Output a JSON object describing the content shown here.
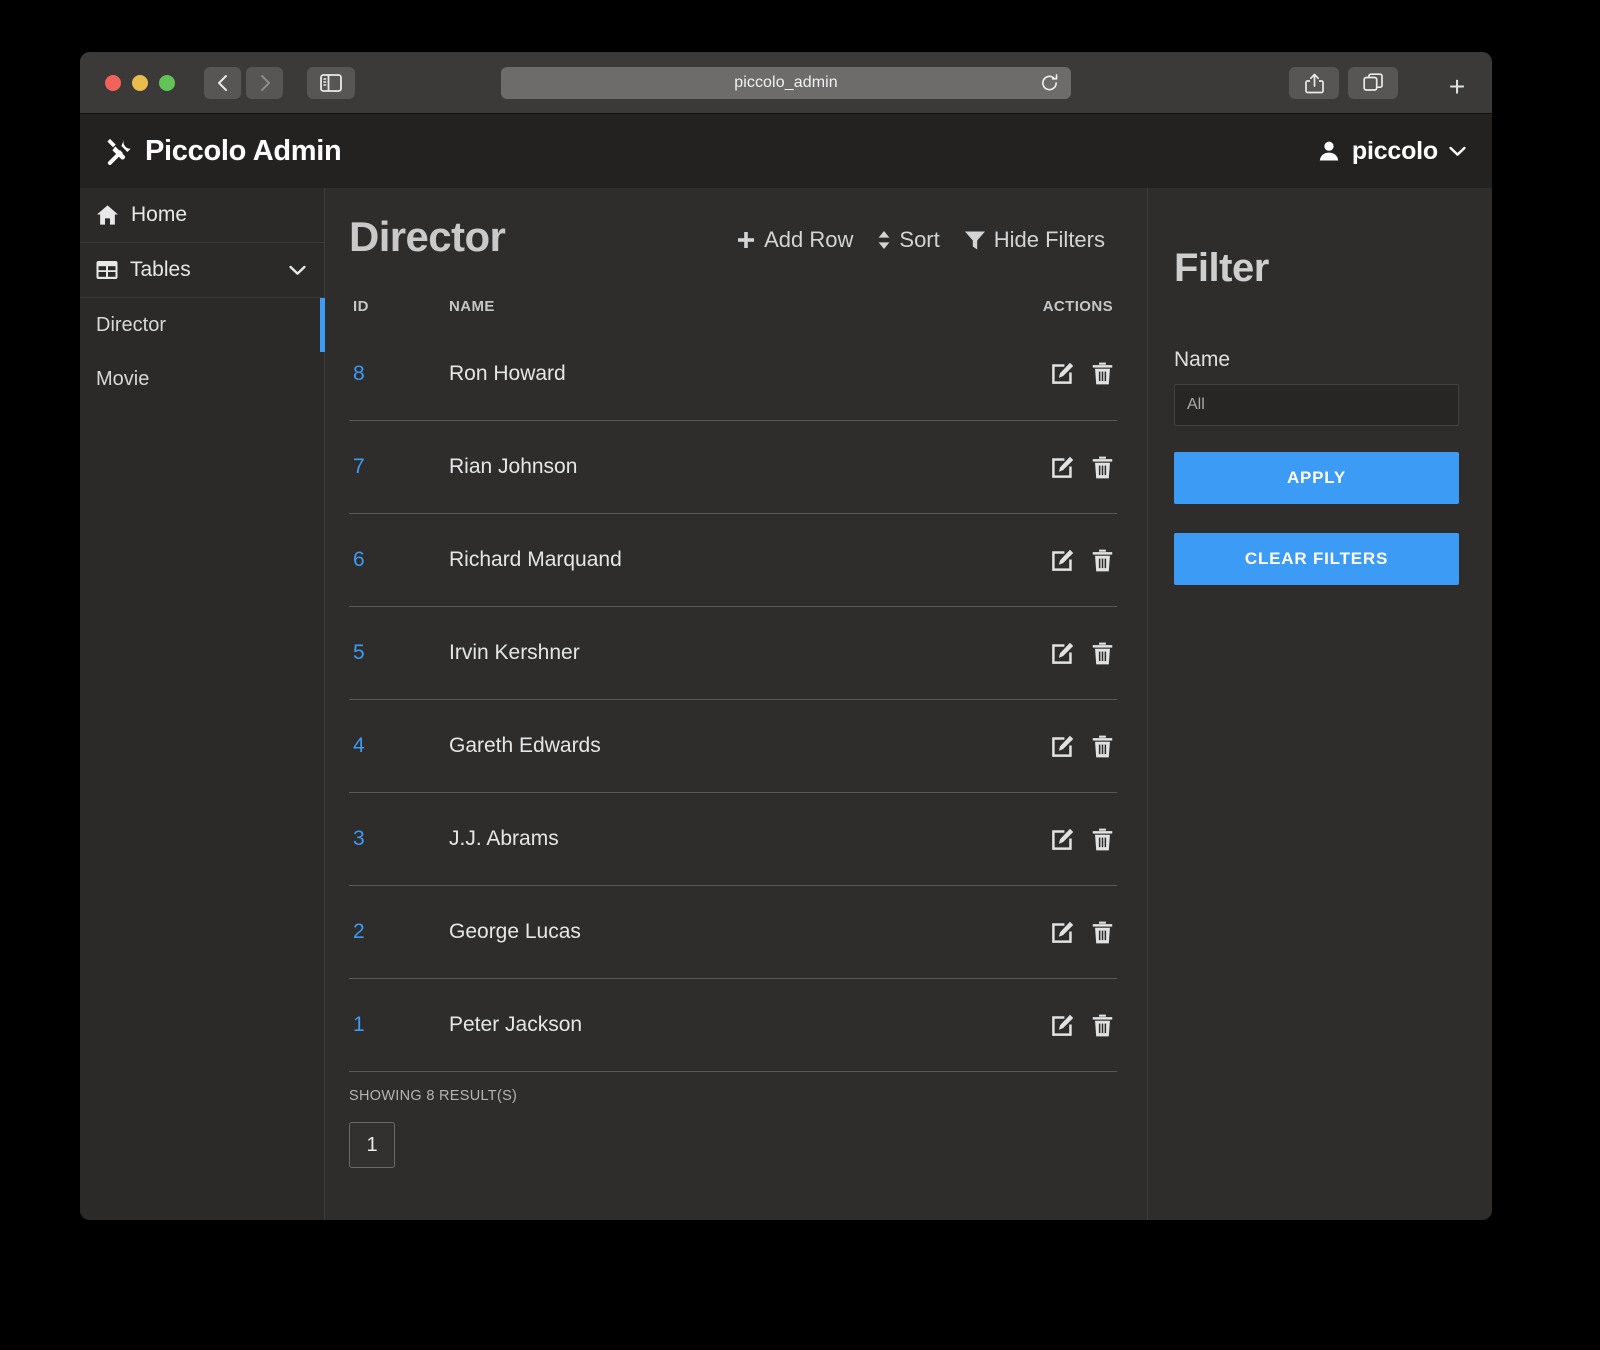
{
  "browser": {
    "url": "piccolo_admin",
    "back_icon": "chevron-left-icon",
    "forward_icon": "chevron-right-icon",
    "sidebar_toggle_icon": "sidebar-toggle-icon",
    "reload_icon": "reload-icon",
    "share_icon": "share-icon",
    "tabs_icon": "tabs-icon",
    "new_tab_label": "+"
  },
  "app_header": {
    "logo_icon": "tools-icon",
    "brand": "Piccolo Admin",
    "user_icon": "person-icon",
    "user_name": "piccolo",
    "user_chevron_icon": "chevron-down-icon"
  },
  "sidebar": {
    "items": [
      {
        "label": "Home",
        "icon": "home-icon",
        "active": false
      },
      {
        "label": "Tables",
        "icon": "table-icon",
        "active": false,
        "chevron": "chevron-down-icon"
      },
      {
        "label": "Director",
        "icon": "",
        "active": true
      },
      {
        "label": "Movie",
        "icon": "",
        "active": false
      }
    ]
  },
  "main": {
    "title": "Director",
    "toolbar": [
      {
        "label": "Add Row",
        "icon": "plus-icon"
      },
      {
        "label": "Sort",
        "icon": "sort-icon"
      },
      {
        "label": "Hide Filters",
        "icon": "funnel-icon"
      }
    ],
    "columns": [
      "ID",
      "NAME",
      "ACTIONS"
    ],
    "rows": [
      {
        "id": "8",
        "name": "Ron Howard"
      },
      {
        "id": "7",
        "name": "Rian Johnson"
      },
      {
        "id": "6",
        "name": "Richard Marquand"
      },
      {
        "id": "5",
        "name": "Irvin Kershner"
      },
      {
        "id": "4",
        "name": "Gareth Edwards"
      },
      {
        "id": "3",
        "name": "J.J. Abrams"
      },
      {
        "id": "2",
        "name": "George Lucas"
      },
      {
        "id": "1",
        "name": "Peter Jackson"
      }
    ],
    "row_actions": {
      "edit_icon": "edit-icon",
      "delete_icon": "trash-icon"
    },
    "showing": "SHOWING 8 RESULT(S)",
    "pages": [
      "1"
    ]
  },
  "filter": {
    "title": "Filter",
    "name_label": "Name",
    "name_value": "",
    "name_placeholder": "All",
    "apply_label": "APPLY",
    "clear_label": "CLEAR FILTERS"
  },
  "colors": {
    "accent": "#3b9bf5",
    "window_bg": "#2e2d2b",
    "sidebar_bg": "#2b2a28",
    "header_bg": "#232220",
    "chrome_bg": "#3b3a38"
  }
}
